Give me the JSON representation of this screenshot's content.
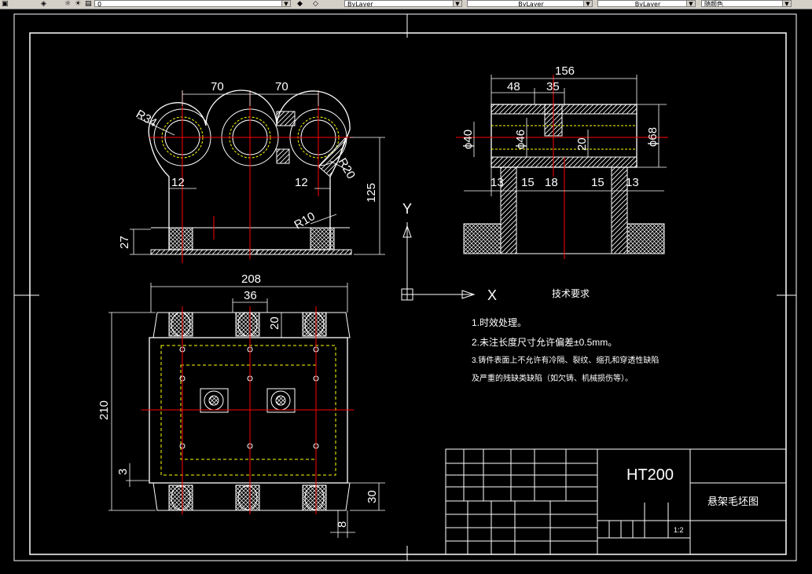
{
  "toolbar": {
    "layer_value": "0",
    "color_value": "ByLayer",
    "linetype_value": "ByLayer",
    "lineweight_value": "ByLayer",
    "plotstyle_value": "随颜色"
  },
  "drawing": {
    "dims_top_view": {
      "d70a": "70",
      "d70b": "70",
      "r34": "R34",
      "d12a": "12",
      "d12b": "12",
      "r20": "R20",
      "r10": "R10",
      "d125": "125",
      "d27": "27"
    },
    "dims_side_view": {
      "d156": "156",
      "d48": "48",
      "d35": "35",
      "phi40": "ϕ40",
      "phi46": "ϕ46",
      "d20": "20",
      "phi68": "ϕ68",
      "d13a": "13",
      "d15a": "15",
      "d18": "18",
      "d15b": "15",
      "d13b": "13"
    },
    "dims_plan_view": {
      "d208": "208",
      "d36": "36",
      "d20": "20",
      "d210": "210",
      "d3": "3",
      "d30": "30",
      "d8": "8"
    },
    "ucs": {
      "y_label": "Y",
      "x_label": "X"
    },
    "tech_req": {
      "title": "技术要求",
      "line1": "1.时效处理。",
      "line2": "2.未注长度尺寸允许偏差±0.5mm。",
      "line3": "3.铸件表面上不允许有冷隔、裂纹、缩孔和穿透性缺陷",
      "line4": "及严重的残缺类缺陷（如欠铸、机械损伤等）。"
    },
    "title_block": {
      "material": "HT200",
      "part_name": "悬架毛坯图",
      "scale": "1:2"
    }
  },
  "colors": {
    "background": "#000000",
    "white": "#ffffff",
    "red": "#ff0000",
    "yellow": "#ffff00",
    "hatch": "#ffffff"
  }
}
